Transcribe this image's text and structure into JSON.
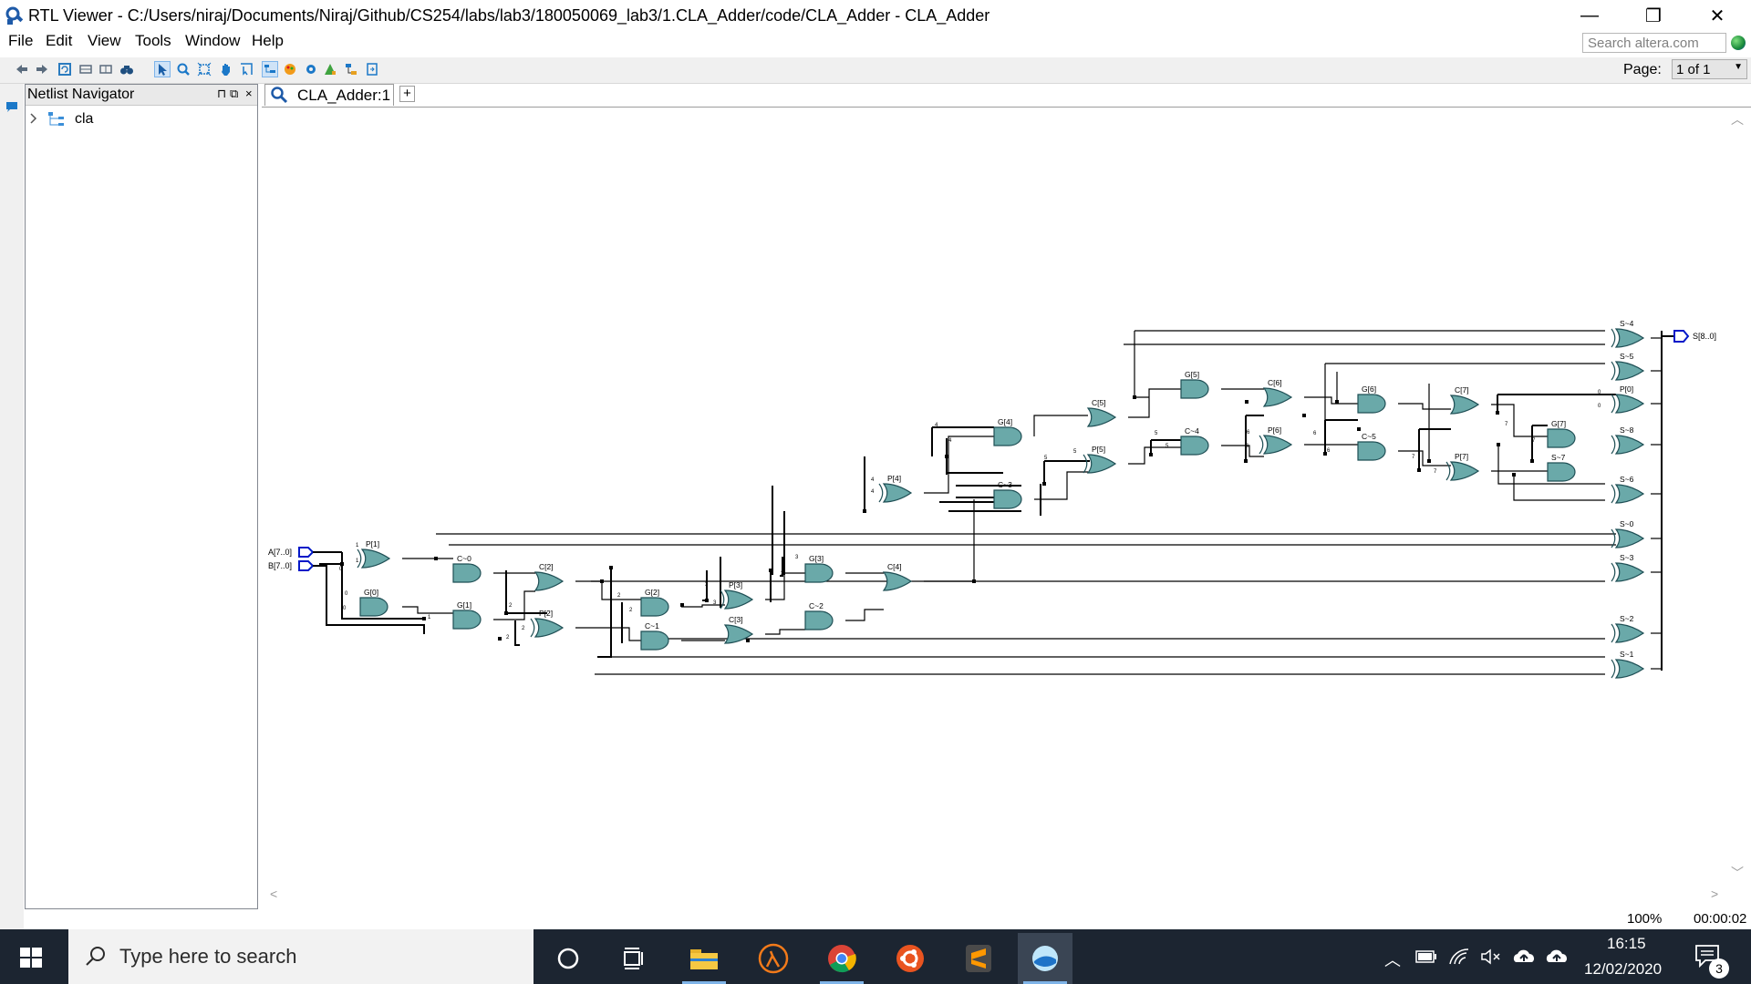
{
  "window": {
    "title": "RTL Viewer - C:/Users/niraj/Documents/Niraj/Github/CS254/labs/lab3/180050069_lab3/1.CLA_Adder/code/CLA_Adder - CLA_Adder",
    "minimize": "—",
    "restore": "❐",
    "close": "✕"
  },
  "menu": [
    "File",
    "Edit",
    "View",
    "Tools",
    "Window",
    "Help"
  ],
  "search": {
    "placeholder": "Search altera.com"
  },
  "page": {
    "label": "Page:",
    "value": "1 of 1"
  },
  "navigator": {
    "title": "Netlist Navigator",
    "items": [
      {
        "label": "cla"
      }
    ]
  },
  "tab": {
    "label": "CLA_Adder:1",
    "add": "+"
  },
  "status": {
    "zoom": "100%",
    "time": "00:00:02"
  },
  "schematic": {
    "ports": {
      "a": "A[7..0]",
      "b": "B[7..0]",
      "s": "S[8..0]"
    },
    "gates": [
      {
        "label": "P[1]",
        "kind": "xor"
      },
      {
        "label": "G[0]",
        "kind": "and"
      },
      {
        "label": "C~0",
        "kind": "and"
      },
      {
        "label": "G[1]",
        "kind": "and"
      },
      {
        "label": "C[2]",
        "kind": "or"
      },
      {
        "label": "P[2]",
        "kind": "xor"
      },
      {
        "label": "G[2]",
        "kind": "and"
      },
      {
        "label": "C~1",
        "kind": "and"
      },
      {
        "label": "P[3]",
        "kind": "xor"
      },
      {
        "label": "C[3]",
        "kind": "or"
      },
      {
        "label": "G[3]",
        "kind": "and"
      },
      {
        "label": "C~2",
        "kind": "and"
      },
      {
        "label": "C[4]",
        "kind": "or"
      },
      {
        "label": "P[4]",
        "kind": "xor"
      },
      {
        "label": "G[4]",
        "kind": "and"
      },
      {
        "label": "C~3",
        "kind": "and"
      },
      {
        "label": "C[5]",
        "kind": "or"
      },
      {
        "label": "P[5]",
        "kind": "xor"
      },
      {
        "label": "G[5]",
        "kind": "and"
      },
      {
        "label": "C~4",
        "kind": "and"
      },
      {
        "label": "C[6]",
        "kind": "or"
      },
      {
        "label": "P[6]",
        "kind": "xor"
      },
      {
        "label": "G[6]",
        "kind": "and"
      },
      {
        "label": "C~5",
        "kind": "and"
      },
      {
        "label": "C[7]",
        "kind": "or"
      },
      {
        "label": "P[7]",
        "kind": "xor"
      },
      {
        "label": "G[7]",
        "kind": "and"
      },
      {
        "label": "S~7",
        "kind": "and"
      },
      {
        "label": "S~4",
        "kind": "xor"
      },
      {
        "label": "S~5",
        "kind": "xor"
      },
      {
        "label": "P[0]",
        "kind": "xor"
      },
      {
        "label": "S~8",
        "kind": "xor"
      },
      {
        "label": "S~6",
        "kind": "xor"
      },
      {
        "label": "S~0",
        "kind": "xor"
      },
      {
        "label": "S~3",
        "kind": "xor"
      },
      {
        "label": "S~2",
        "kind": "xor"
      },
      {
        "label": "S~1",
        "kind": "xor"
      }
    ]
  },
  "taskbar": {
    "search_placeholder": "Type here to search",
    "time": "16:15",
    "date": "12/02/2020",
    "notifications": "3",
    "apps": [
      "task-view",
      "file-explorer",
      "half-life",
      "chrome",
      "ubuntu",
      "sublime-text",
      "quartus"
    ]
  }
}
